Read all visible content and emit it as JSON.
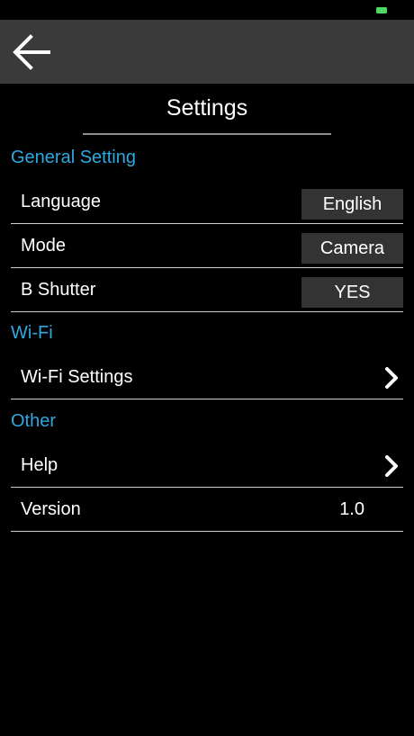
{
  "header": {
    "title": "Settings"
  },
  "sections": {
    "general": {
      "title": "General Setting",
      "language": {
        "label": "Language",
        "value": "English"
      },
      "mode": {
        "label": "Mode",
        "value": "Camera"
      },
      "b_shutter": {
        "label": "B Shutter",
        "value": "YES"
      }
    },
    "wifi": {
      "title": "Wi-Fi",
      "wifi_settings": {
        "label": "Wi-Fi Settings"
      }
    },
    "other": {
      "title": "Other",
      "help": {
        "label": "Help"
      },
      "version": {
        "label": "Version",
        "value": "1.0"
      }
    }
  },
  "icons": {
    "back": "arrow-left-icon",
    "chevron": "chevron-right-icon",
    "battery": "battery-icon"
  },
  "colors": {
    "background": "#000000",
    "nav_bar": "#3a3a3a",
    "section_header": "#2ea8e0",
    "value_button": "#333333",
    "battery": "#4cd964"
  }
}
